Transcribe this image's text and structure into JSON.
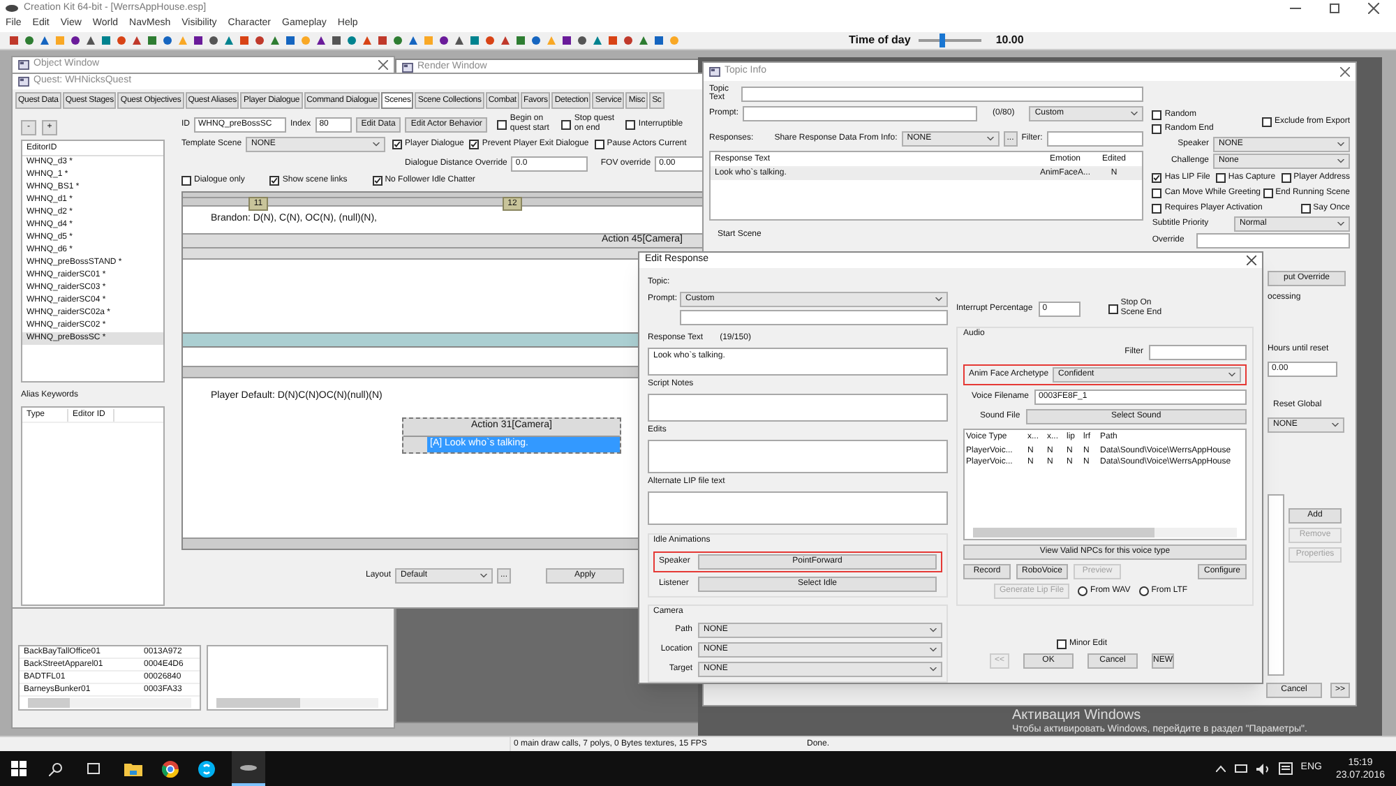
{
  "app": {
    "title": "Creation Kit 64-bit - [WerrsAppHouse.esp]",
    "menu": [
      "File",
      "Edit",
      "View",
      "World",
      "NavMesh",
      "Visibility",
      "Character",
      "Gameplay",
      "Help"
    ],
    "time_of_day": {
      "label": "Time of day",
      "level": 0.35,
      "value": "10.00"
    }
  },
  "object_window": {
    "title": "Object Window",
    "rows": [
      {
        "name": "BackBayTallOffice01",
        "id": "0013A972"
      },
      {
        "name": "BackStreetApparel01",
        "id": "0004E4D6"
      },
      {
        "name": "BADTFL01",
        "id": "00026840"
      },
      {
        "name": "BarneysBunker01",
        "id": "0003FA33"
      }
    ]
  },
  "render_window": {
    "title": "Render Window"
  },
  "quest_window": {
    "title": "Quest: WHNicksQuest",
    "tabs": [
      {
        "label": "Quest Data",
        "selected": false
      },
      {
        "label": "Quest Stages",
        "selected": false
      },
      {
        "label": "Quest Objectives",
        "selected": false
      },
      {
        "label": "Quest Aliases",
        "selected": false
      },
      {
        "label": "Player Dialogue",
        "selected": false
      },
      {
        "label": "Command Dialogue",
        "selected": false
      },
      {
        "label": "Scenes",
        "selected": true
      },
      {
        "label": "Scene Collections",
        "selected": false
      },
      {
        "label": "Combat",
        "selected": false
      },
      {
        "label": "Favors",
        "selected": false
      },
      {
        "label": "Detection",
        "selected": false
      },
      {
        "label": "Service",
        "selected": false
      },
      {
        "label": "Misc",
        "selected": false
      },
      {
        "label": "Sc",
        "selected": false
      }
    ],
    "list_buttons": [
      "-",
      "+"
    ],
    "list_header": "EditorID",
    "scenes": [
      {
        "label": "WHNQ_d3 *",
        "selected": false
      },
      {
        "label": "WHNQ_1 *",
        "selected": false
      },
      {
        "label": "WHNQ_BS1 *",
        "selected": false
      },
      {
        "label": "WHNQ_d1 *",
        "selected": false
      },
      {
        "label": "WHNQ_d2 *",
        "selected": false
      },
      {
        "label": "WHNQ_d4 *",
        "selected": false
      },
      {
        "label": "WHNQ_d5 *",
        "selected": false
      },
      {
        "label": "WHNQ_d6 *",
        "selected": false
      },
      {
        "label": "WHNQ_preBossSTAND *",
        "selected": false
      },
      {
        "label": "WHNQ_raiderSC01 *",
        "selected": false
      },
      {
        "label": "WHNQ_raiderSC03 *",
        "selected": false
      },
      {
        "label": "WHNQ_raiderSC04 *",
        "selected": false
      },
      {
        "label": "WHNQ_raiderSC02a *",
        "selected": false
      },
      {
        "label": "WHNQ_raiderSC02 *",
        "selected": false
      },
      {
        "label": "WHNQ_preBossSC *",
        "selected": true
      }
    ],
    "alias_keywords": {
      "label": "Alias Keywords",
      "columns": [
        "Type",
        "Editor ID"
      ]
    },
    "id": {
      "label": "ID",
      "value": "WHNQ_preBossSC"
    },
    "index": {
      "label": "Index",
      "value": "80"
    },
    "buttons": [
      "Edit Data",
      "Edit Actor Behavior"
    ],
    "checks_top": [
      {
        "label": "Begin on quest start",
        "checked": false
      },
      {
        "label": "Stop quest on end",
        "checked": false
      },
      {
        "label": "Interruptible",
        "checked": false
      }
    ],
    "template_scene": {
      "label": "Template Scene",
      "value": "NONE"
    },
    "checks_mid": [
      {
        "label": "Player Dialogue",
        "checked": true
      },
      {
        "label": "Prevent Player Exit Dialogue",
        "checked": true
      },
      {
        "label": "Pause Actors Current",
        "checked": false
      }
    ],
    "dialogue_distance": {
      "label": "Dialogue Distance Override",
      "value": "0.0"
    },
    "fov": {
      "label": "FOV override",
      "value": "0.00"
    },
    "checks_bottom": [
      {
        "label": "Dialogue only",
        "checked": false
      },
      {
        "label": "Show scene links",
        "checked": true
      },
      {
        "label": "No Follower Idle Chatter",
        "checked": true
      }
    ],
    "scene": {
      "phases": [
        "11",
        "12"
      ],
      "brandon": "Brandon: D(N), C(N), OC(N), (null)(N),",
      "action_45": "Action 45[Camera]",
      "player": "Player Default: D(N)C(N)OC(N)(null)(N)",
      "action_31": "Action 31[Camera]",
      "action_31_line": "[A] Look who`s talking."
    },
    "layout": {
      "label": "Layout",
      "value": "Default",
      "more": "..."
    },
    "apply": "Apply"
  },
  "topic_info": {
    "title": "Topic Info",
    "topic_text": "Topic Text",
    "prompt": {
      "label": "Prompt:",
      "count": "(0/80)",
      "value": "Custom"
    },
    "responses": {
      "label": "Responses:",
      "share_label": "Share Response Data From Info:",
      "share_value": "NONE",
      "more": "...",
      "filter": "Filter:"
    },
    "table": {
      "columns": [
        "Response Text",
        "Emotion",
        "Edited"
      ],
      "rows": [
        [
          "Look who`s talking.",
          "AnimFaceA...",
          "N"
        ]
      ]
    },
    "start_scene": "Start Scene",
    "checks_random": [
      {
        "label": "Random",
        "checked": false
      },
      {
        "label": "Random End",
        "checked": false
      }
    ],
    "exclude": {
      "label": "Exclude from Export",
      "checked": false
    },
    "speaker": {
      "label": "Speaker",
      "value": "NONE"
    },
    "challenge": {
      "label": "Challenge",
      "value": "None"
    },
    "flags": [
      [
        {
          "label": "Has LIP File",
          "checked": true
        },
        {
          "label": "Has Capture",
          "checked": false
        },
        {
          "label": "Player Address",
          "checked": false
        }
      ],
      [
        {
          "label": "Can Move While Greeting",
          "checked": false
        },
        {
          "label": "End Running Scene",
          "checked": false
        }
      ],
      [
        {
          "label": "Requires Player Activation",
          "checked": false
        },
        {
          "label": "Say Once",
          "checked": false
        }
      ]
    ],
    "subtitle": {
      "label": "Subtitle Priority",
      "value": "Normal"
    },
    "override": "Override",
    "override_button": "put Override",
    "processing": "ocessing",
    "hours": {
      "label": "Hours until reset",
      "value": "0.00"
    },
    "reset_global": {
      "label": "Reset Global",
      "value": "NONE"
    },
    "list_buttons": [
      {
        "label": "Add",
        "disabled": false
      },
      {
        "label": "Remove",
        "disabled": true
      },
      {
        "label": "Properties",
        "disabled": true
      }
    ],
    "bottom_buttons": [
      "Cancel",
      ">>"
    ]
  },
  "edit_response": {
    "title": "Edit Response",
    "topic": "Topic:",
    "prompt": {
      "label": "Prompt:",
      "value": "Custom"
    },
    "response_text": {
      "label": "Response Text",
      "count": "(19/150)",
      "value": "Look who`s talking."
    },
    "script_notes": "Script Notes",
    "edits": "Edits",
    "alt_lip": "Alternate LIP file text",
    "idle": {
      "label": "Idle Animations",
      "speaker": "Speaker",
      "speaker_value": "PointForward",
      "listener": "Listener",
      "listener_value": "Select Idle"
    },
    "camera": {
      "label": "Camera",
      "rows": [
        {
          "label": "Path",
          "value": "NONE"
        },
        {
          "label": "Location",
          "value": "NONE"
        },
        {
          "label": "Target",
          "value": "NONE"
        }
      ]
    },
    "interrupt": {
      "label": "Interrupt Percentage",
      "value": "0"
    },
    "stop_on_end": {
      "label": "Stop On Scene End",
      "checked": false
    },
    "audio": {
      "label": "Audio",
      "filter": "Filter",
      "archetype_label": "Anim Face Archetype",
      "archetype": "Confident",
      "voice_label": "Voice Filename",
      "voice": "0003FE8F_1",
      "sound_label": "Sound File",
      "sound_button": "Select Sound",
      "columns": [
        "Voice Type",
        "x...",
        "x...",
        "lip",
        "lrf",
        "Path"
      ],
      "rows": [
        [
          "PlayerVoic...",
          "N",
          "N",
          "N",
          "N",
          "Data\\Sound\\Voice\\WerrsAppHouse"
        ],
        [
          "PlayerVoic...",
          "N",
          "N",
          "N",
          "N",
          "Data\\Sound\\Voice\\WerrsAppHouse"
        ]
      ],
      "view_npcs": "View Valid NPCs for this voice type",
      "buttons": [
        {
          "label": "Record",
          "disabled": false
        },
        {
          "label": "RoboVoice",
          "disabled": false
        },
        {
          "label": "Preview",
          "disabled": true
        }
      ],
      "configure": "Configure",
      "generate": {
        "label": "Generate Lip File",
        "disabled": true
      },
      "radios": [
        {
          "label": "From WAV",
          "selected": false
        },
        {
          "label": "From LTF",
          "selected": false
        }
      ]
    },
    "minor_edit": {
      "label": "Minor Edit",
      "checked": false
    },
    "buttons": [
      {
        "label": "<<",
        "disabled": true
      },
      {
        "label": "OK",
        "disabled": false
      },
      {
        "label": "Cancel",
        "disabled": false
      },
      {
        "label": "NEW",
        "disabled": false
      }
    ]
  },
  "activation": {
    "title": "Активация Windows",
    "text": "Чтобы активировать Windows, перейдите в раздел \"Параметры\"."
  },
  "status_bar": [
    "0 main draw calls, 7 polys, 0 Bytes textures, 15 FPS",
    "Done."
  ],
  "taskbar": {
    "language": "ENG",
    "time": "15:19",
    "date": "23.07.2016"
  }
}
